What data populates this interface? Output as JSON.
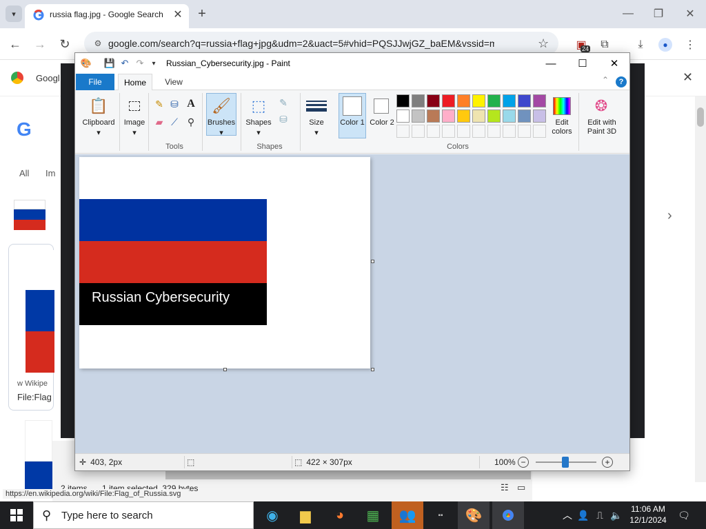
{
  "chrome": {
    "tab_title": "russia flag.jpg - Google Search",
    "url": "google.com/search?q=russia+flag+jpg&udm=2&uact=5#vhid=PQSJJwjGZ_baEM&vssid=mosaic",
    "extension_badge": "24",
    "status_url": "https://en.wikipedia.org/wiki/File:Flag_of_Russia.svg"
  },
  "background_page": {
    "bookmark_text": "Googl",
    "sidebar_texts": [
      "All",
      "Im"
    ],
    "result_source": "w Wikipe",
    "result_title": "File:Flag"
  },
  "explorer": {
    "items_count": "2 items",
    "selection": "1 item selected  329 bytes"
  },
  "paint": {
    "title": "Russian_Cybersecurity.jpg - Paint",
    "tabs": {
      "file": "File",
      "home": "Home",
      "view": "View"
    },
    "groups": {
      "clipboard": "Clipboard",
      "image": "Image",
      "tools": "Tools",
      "brushes": "Brushes",
      "shapes": "Shapes",
      "size": "Size",
      "color1": "Color 1",
      "color2": "Color 2",
      "colors": "Colors",
      "edit_colors": "Edit colors",
      "edit_paint3d": "Edit with Paint 3D"
    },
    "palette": [
      "#000000",
      "#7f7f7f",
      "#880015",
      "#ed1c24",
      "#ff7f27",
      "#fff200",
      "#22b14c",
      "#00a2e8",
      "#3f48cc",
      "#a349a4",
      "#ffffff",
      "#c3c3c3",
      "#b97a57",
      "#ffaec9",
      "#ffc90e",
      "#efe4b0",
      "#b5e61d",
      "#99d9ea",
      "#7092be",
      "#c8bfe7"
    ],
    "image": {
      "stripes": [
        "#0032a0",
        "#d52b1e",
        "#000000"
      ],
      "caption": "Russian Cybersecurity"
    },
    "status": {
      "cursor_pos": "403, 2px",
      "image_size": "422 × 307px",
      "zoom": "100%"
    }
  },
  "taskbar": {
    "search_placeholder": "Type here to search",
    "time": "11:06 AM",
    "date": "12/1/2024"
  }
}
